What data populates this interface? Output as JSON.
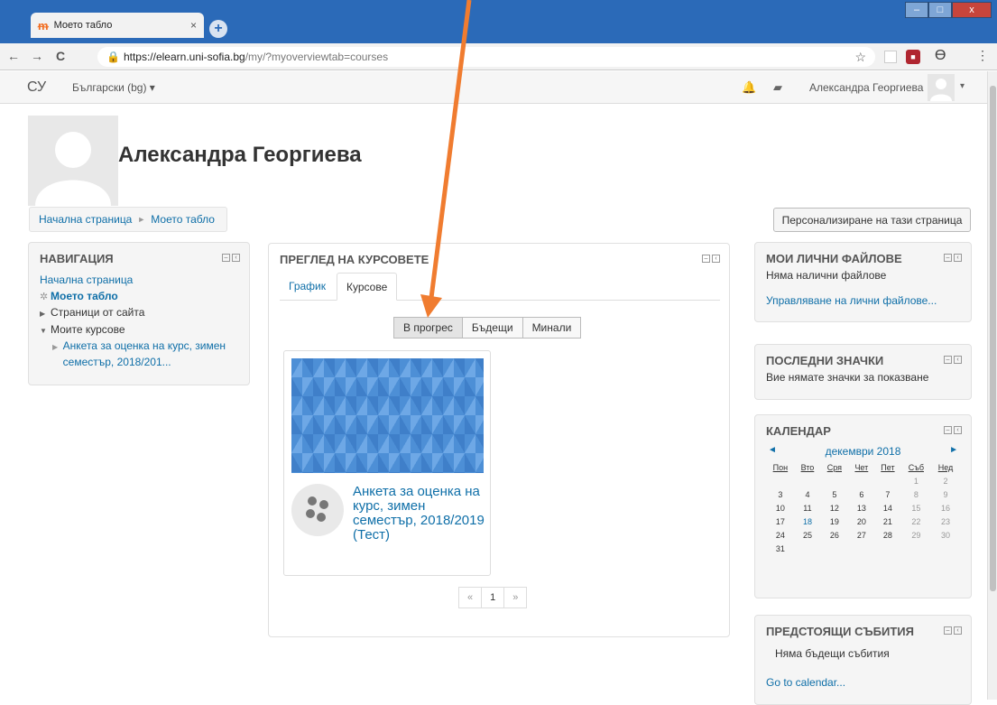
{
  "browser": {
    "tab_title": "Моето табло",
    "tab_favicon": "moodle-icon",
    "tab_close": "×",
    "new_tab": "+",
    "url_host": "https://elearn.uni-sofia.bg",
    "url_path": "/my/?myoverviewtab=courses",
    "back": "←",
    "forward": "→",
    "reload": "C",
    "star": "☆",
    "account": "ϴ",
    "menu": "⋮",
    "window": {
      "min": "–",
      "max": "□",
      "close": "x"
    }
  },
  "navbar": {
    "brand": "СУ",
    "language": "Български (bg) ▾",
    "user_name": "Александра Георгиева",
    "caret": "▾"
  },
  "page": {
    "title": "Александра Георгиева",
    "breadcrumb": [
      "Начална страница",
      "Моето табло"
    ],
    "customize_button": "Персонализиране на тази страница"
  },
  "navigation_block": {
    "title": "НАВИГАЦИЯ",
    "items": [
      "Начална страница",
      "Моето табло",
      "Страници от сайта",
      "Моите курсове",
      "Анкета за оценка на курс, зимен семестър, 2018/201..."
    ]
  },
  "course_overview": {
    "title": "ПРЕГЛЕД НА КУРСОВЕТЕ",
    "tabs": [
      "График",
      "Курсове"
    ],
    "active_tab": "Курсове",
    "filters": [
      "В прогрес",
      "Бъдещи",
      "Минали"
    ],
    "active_filter": "В прогрес",
    "course": {
      "title": "Анкета за оценка на курс, зимен семестър, 2018/2019 (Тест)"
    },
    "pagination": [
      "«",
      "1",
      "»"
    ]
  },
  "files_block": {
    "title": "МОИ ЛИЧНИ ФАЙЛОВЕ",
    "text": "Няма налични файлове",
    "link": "Управляване на лични файлове..."
  },
  "badges_block": {
    "title": "ПОСЛЕДНИ ЗНАЧКИ",
    "text": "Вие нямате значки за показване"
  },
  "calendar_block": {
    "title": "КАЛЕНДАР",
    "month": "декември 2018",
    "prev": "◄",
    "next": "►",
    "weekdays": [
      "Пон",
      "Вто",
      "Сря",
      "Чет",
      "Пет",
      "Съб",
      "Нед"
    ],
    "weeks": [
      [
        "",
        "",
        "",
        "",
        "",
        "1",
        "2"
      ],
      [
        "3",
        "4",
        "5",
        "6",
        "7",
        "8",
        "9"
      ],
      [
        "10",
        "11",
        "12",
        "13",
        "14",
        "15",
        "16"
      ],
      [
        "17",
        "18",
        "19",
        "20",
        "21",
        "22",
        "23"
      ],
      [
        "24",
        "25",
        "26",
        "27",
        "28",
        "29",
        "30"
      ],
      [
        "31",
        "",
        "",
        "",
        "",
        "",
        ""
      ]
    ],
    "today": "18"
  },
  "events_block": {
    "title": "ПРЕДСТОЯЩИ СЪБИТИЯ",
    "text": "Няма бъдещи събития",
    "link": "Go to calendar..."
  },
  "colors": {
    "link": "#0f6fa8",
    "chrome": "#2b6ab8",
    "annotation_arrow": "#f07c30"
  }
}
